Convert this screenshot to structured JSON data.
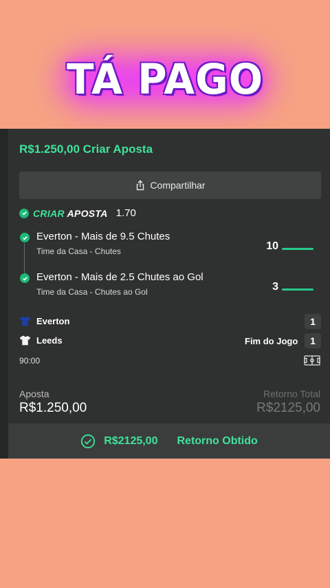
{
  "banner": {
    "text": "TÁ PAGO"
  },
  "bet": {
    "header": "R$1.250,00 Criar Aposta",
    "share_label": "Compartilhar",
    "criar_aposta_prefix": "CRIAR",
    "criar_aposta_suffix": "APOSTA",
    "odds": "1.70",
    "legs": [
      {
        "title": "Everton - Mais de 9.5 Chutes",
        "subtitle": "Time da Casa - Chutes",
        "value": "10"
      },
      {
        "title": "Everton - Mais de 2.5 Chutes ao Gol",
        "subtitle": "Time da Casa - Chutes ao Gol",
        "value": "3"
      }
    ],
    "match": {
      "home": {
        "name": "Everton",
        "score": "1"
      },
      "away": {
        "name": "Leeds",
        "score": "1"
      },
      "status": "Fim do Jogo",
      "time": "90:00"
    },
    "stake_label": "Aposta",
    "stake_value": "R$1.250,00",
    "return_label": "Retorno Total",
    "return_value": "R$2125,00",
    "result_amount": "R$2125,00",
    "result_label": "Retorno Obtido"
  },
  "colors": {
    "background": "#f6a283",
    "accent": "#3fe39a",
    "card": "#2f3030",
    "glow": "#e637ff"
  }
}
